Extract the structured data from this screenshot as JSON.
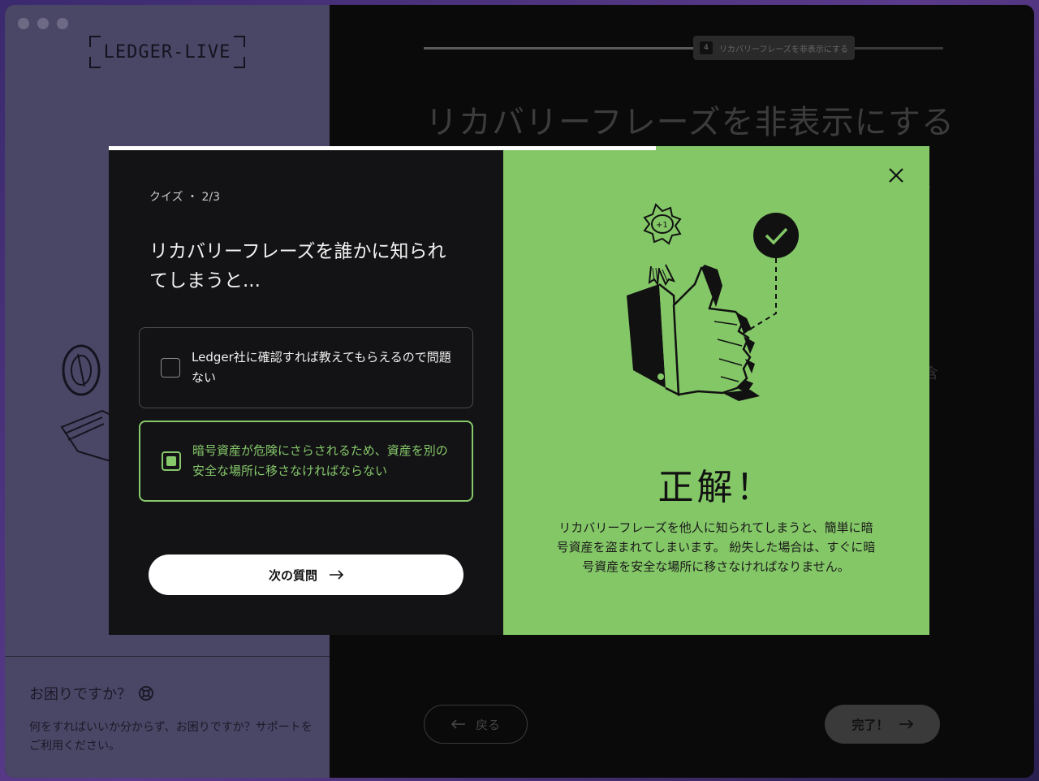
{
  "window": {
    "logo_text": "LEDGER-LIVE"
  },
  "sidebar": {
    "help_title": "お困りですか？",
    "help_text": "何をすればいいか分からず、お困りですか？サポートをご利用ください。"
  },
  "main": {
    "step_number": "4",
    "step_label": "リカバリーフレーズを非表示にする",
    "title": "リカバリーフレーズを非表示にする",
    "back_label": "戻る",
    "done_label": "完了！",
    "partial_glyph_1": "♪",
    "partial_glyph_2": "含"
  },
  "quiz": {
    "progress": 0.667,
    "label": "クイズ ・ 2/3",
    "question": "リカバリーフレーズを誰かに知られてしまうと...",
    "options": [
      {
        "text": "Ledger社に確認すれば教えてもらえるので問題ない",
        "selected": false
      },
      {
        "text": "暗号資産が危険にさらされるため、資産を別の安全な場所に移さなければならない",
        "selected": true
      }
    ],
    "next_label": "次の質問"
  },
  "result": {
    "badge_text": "+1",
    "title": "正解！",
    "text": "リカバリーフレーズを他人に知られてしまうと、簡単に暗号資産を盗まれてしまいます。 紛失した場合は、すぐに暗号資産を安全な場所に移さなければなりません。"
  },
  "colors": {
    "accent_green": "#84c767",
    "modal_dark": "#131315",
    "sidebar_dim": "#4a4666"
  },
  "icons": {
    "help": "help-ring-icon",
    "close": "close-icon",
    "arrow_right": "arrow-right-icon",
    "arrow_left": "arrow-left-icon",
    "check": "check-circle-icon"
  }
}
